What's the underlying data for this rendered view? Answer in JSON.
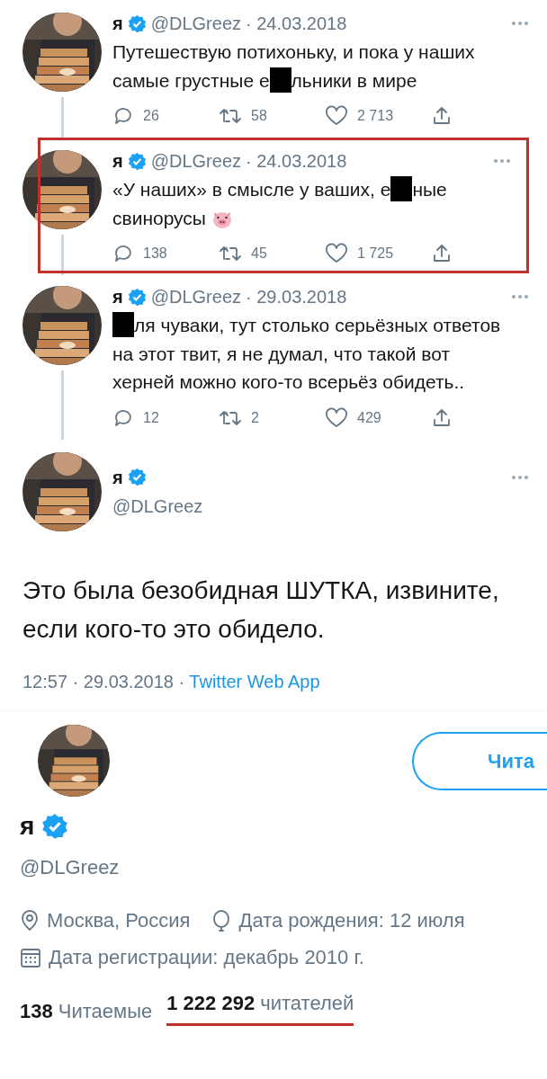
{
  "thread": [
    {
      "name": "я",
      "verified": true,
      "handle": "@DLGreez",
      "date": "· 24.03.2018",
      "highlighted": false,
      "thread_line": true,
      "text": [
        {
          "kind": "text",
          "value": "Путешествую потихоньку, и пока у наших самые грустные е"
        },
        {
          "kind": "redaction"
        },
        {
          "kind": "text",
          "value": "льники в мире"
        }
      ],
      "replies": "26",
      "retweets": "58",
      "likes": "2 713"
    },
    {
      "name": "я",
      "verified": true,
      "handle": "@DLGreez",
      "date": "· 24.03.2018",
      "highlighted": true,
      "thread_line": true,
      "text": [
        {
          "kind": "text",
          "value": "«У наших» в смысле у ваших, е"
        },
        {
          "kind": "redaction"
        },
        {
          "kind": "text",
          "value": "ные свинорусы "
        },
        {
          "kind": "emoji"
        }
      ],
      "replies": "138",
      "retweets": "45",
      "likes": "1 725"
    },
    {
      "name": "я",
      "verified": true,
      "handle": "@DLGreez",
      "date": "· 29.03.2018",
      "highlighted": false,
      "thread_line": true,
      "text": [
        {
          "kind": "redaction"
        },
        {
          "kind": "text",
          "value": "ля чуваки, тут столько серьёзных ответов на этот твит, я не думал, что такой вот херней можно кого-то всерьёз обидеть.."
        }
      ],
      "replies": "12",
      "retweets": "2",
      "likes": "429"
    }
  ],
  "main_tweet": {
    "name": "я",
    "verified": true,
    "handle": "@DLGreez",
    "text": "Это была безобидная ШУТКА, извините, если кого-то это обидело.",
    "time": "12:57 · 29.03.2018 · ",
    "source": "Twitter Web App"
  },
  "profile": {
    "follow_button": "Чита",
    "name": "я",
    "verified": true,
    "handle": "@DLGreez",
    "location": "Москва, Россия",
    "birthday": "Дата рождения: 12 июля",
    "joined": "Дата регистрации: декабрь 2010 г.",
    "following_count": "138",
    "following_label": "Читаемые",
    "followers_count": "1 222 292",
    "followers_label": "читателей",
    "followers_underlined": true
  }
}
